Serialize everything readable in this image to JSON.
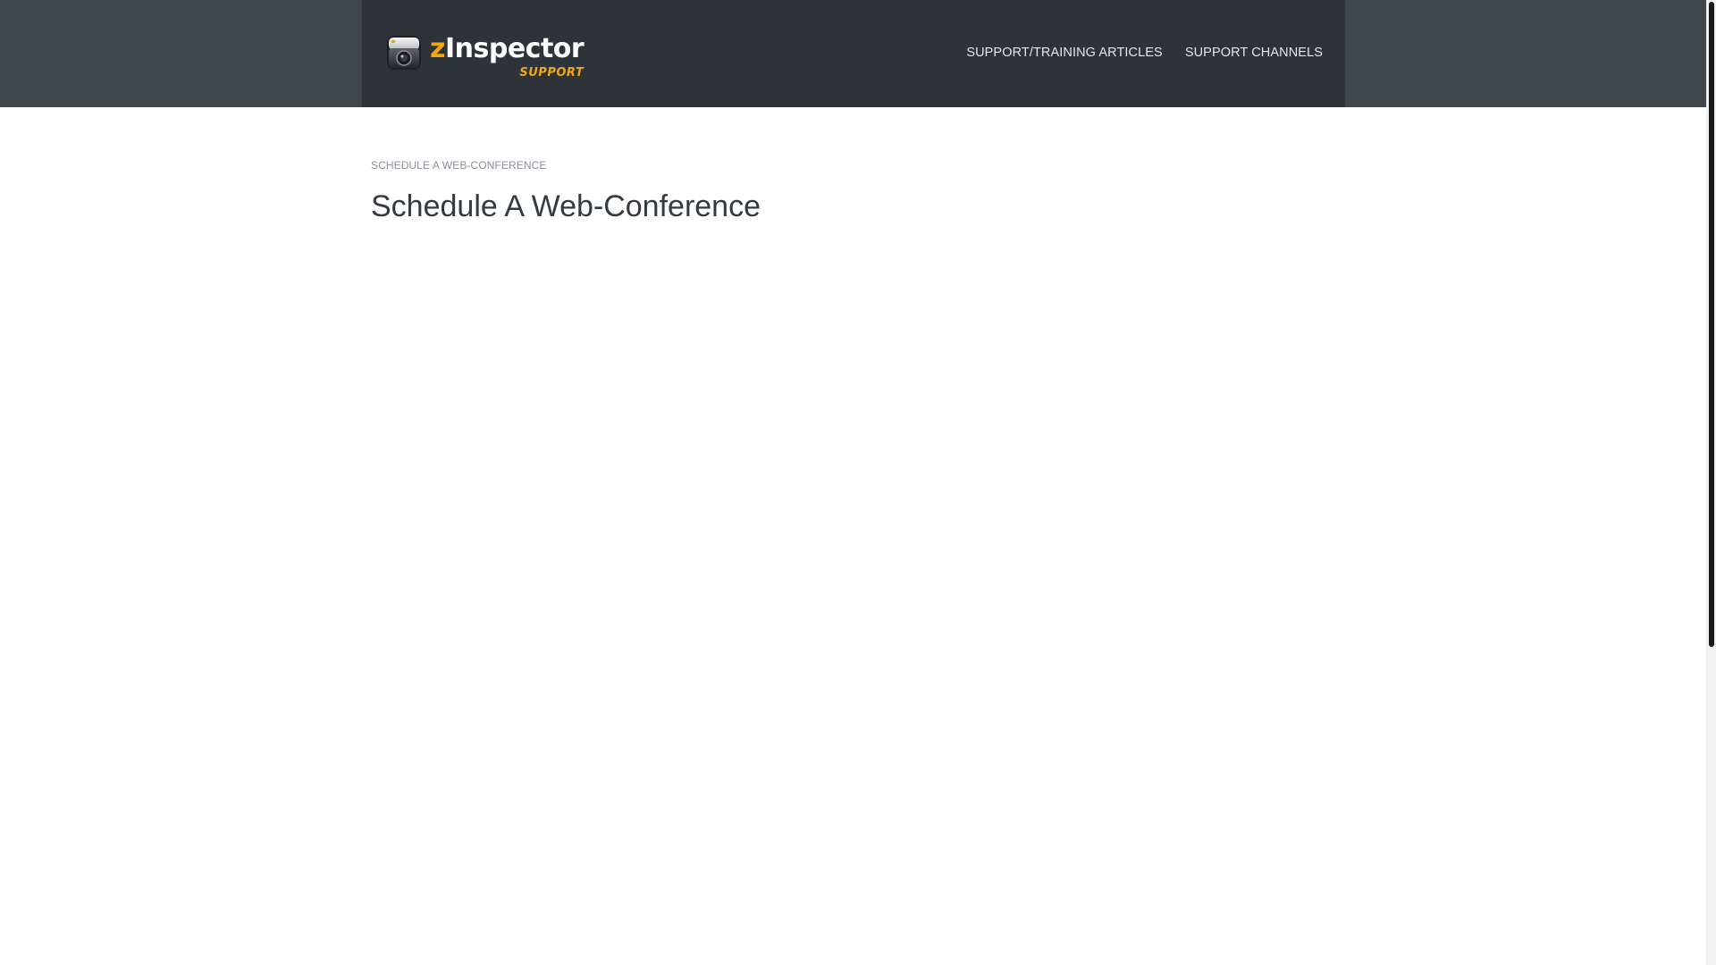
{
  "header": {
    "logo": {
      "prefix": "z",
      "name": "Inspector",
      "tagline": "SUPPORT"
    },
    "nav": [
      {
        "label": "SUPPORT/TRAINING ARTICLES"
      },
      {
        "label": "SUPPORT CHANNELS"
      }
    ]
  },
  "main": {
    "breadcrumb": "SCHEDULE A WEB-CONFERENCE",
    "title": "Schedule A Web-Conference"
  },
  "icons": {
    "logo": "camera-inspector-icon"
  },
  "colors": {
    "header_outer": "#3e464e",
    "header_inner": "#2d3339",
    "accent": "#f1a711"
  }
}
